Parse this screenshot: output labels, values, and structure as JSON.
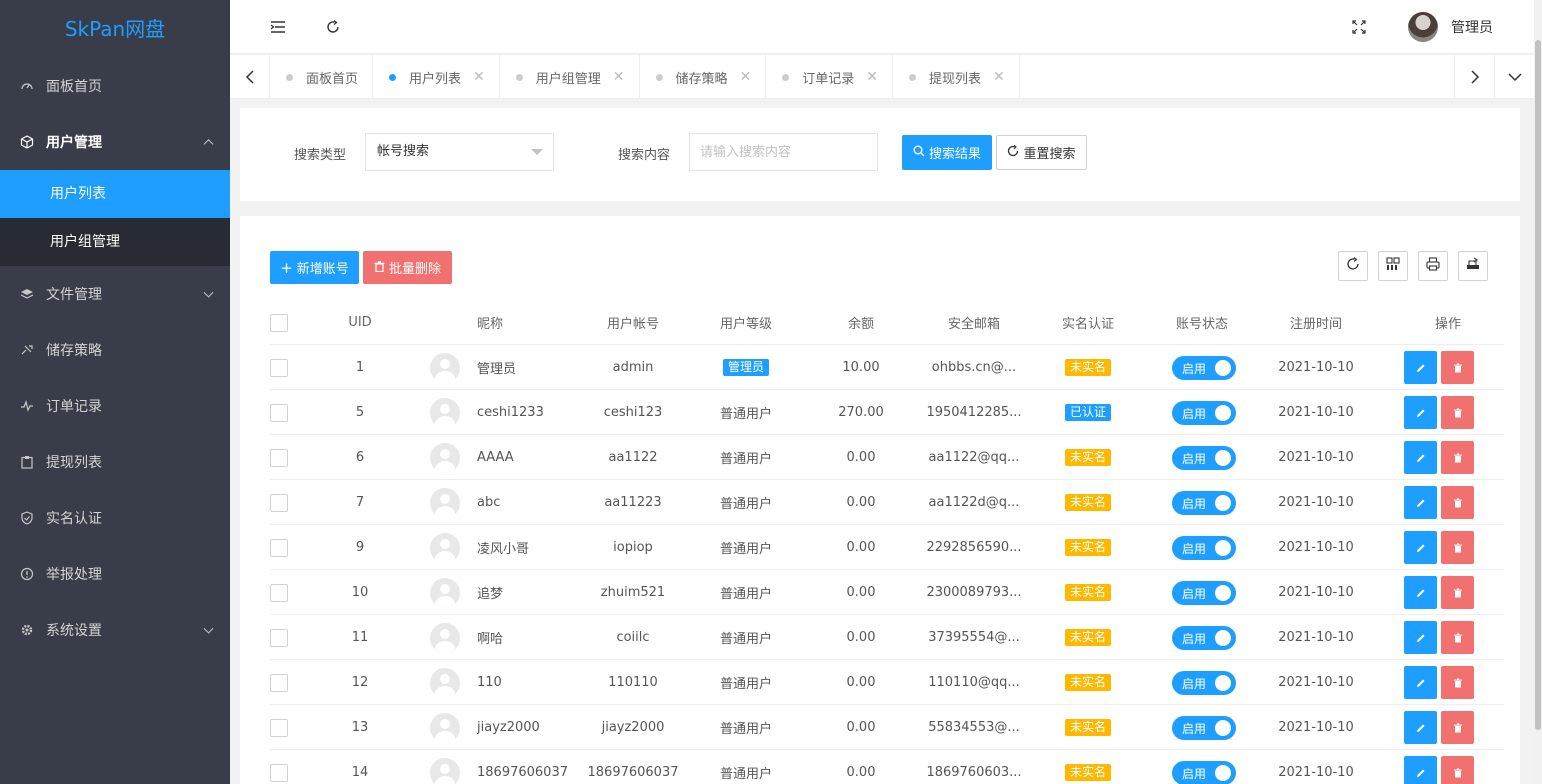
{
  "app": {
    "logo": "SkPan网盘"
  },
  "header": {
    "user_name": "管理员"
  },
  "sidebar": {
    "items": [
      {
        "label": "面板首页",
        "icon": "dashboard-icon"
      },
      {
        "label": "用户管理",
        "icon": "cube-icon",
        "open": true,
        "children": [
          {
            "label": "用户列表",
            "active": true
          },
          {
            "label": "用户组管理"
          }
        ]
      },
      {
        "label": "文件管理",
        "icon": "layers-icon"
      },
      {
        "label": "储存策略",
        "icon": "strategy-icon"
      },
      {
        "label": "订单记录",
        "icon": "pulse-icon"
      },
      {
        "label": "提现列表",
        "icon": "clipboard-icon"
      },
      {
        "label": "实名认证",
        "icon": "shield-check-icon"
      },
      {
        "label": "举报处理",
        "icon": "alert-circle-icon"
      },
      {
        "label": "系统设置",
        "icon": "gear-icon"
      }
    ]
  },
  "tabs": [
    {
      "label": "面板首页",
      "closable": false
    },
    {
      "label": "用户列表",
      "closable": true,
      "active": true
    },
    {
      "label": "用户组管理",
      "closable": true
    },
    {
      "label": "储存策略",
      "closable": true
    },
    {
      "label": "订单记录",
      "closable": true
    },
    {
      "label": "提现列表",
      "closable": true
    }
  ],
  "search": {
    "type_label": "搜索类型",
    "type_value": "帐号搜索",
    "content_label": "搜索内容",
    "content_placeholder": "请输入搜索内容",
    "search_button": "搜索结果",
    "reset_button": "重置搜索"
  },
  "toolbar": {
    "add_button": "新增账号",
    "batch_delete_button": "批量删除"
  },
  "table": {
    "columns": [
      "UID",
      "昵称",
      "用户帐号",
      "用户等级",
      "余额",
      "安全邮箱",
      "实名认证",
      "账号状态",
      "注册时间",
      "操作"
    ],
    "status_label": "启用",
    "rows": [
      {
        "uid": "1",
        "nickname": "管理员",
        "account": "admin",
        "level": "管理员",
        "balance": "10.00",
        "email": "ohbbs.cn@...",
        "verify": "未实名",
        "date": "2021-10-10"
      },
      {
        "uid": "5",
        "nickname": "ceshi1233",
        "account": "ceshi123",
        "level": "普通用户",
        "balance": "270.00",
        "email": "1950412285...",
        "verify": "已认证",
        "date": "2021-10-10"
      },
      {
        "uid": "6",
        "nickname": "AAAA",
        "account": "aa1122",
        "level": "普通用户",
        "balance": "0.00",
        "email": "aa1122@qq...",
        "verify": "未实名",
        "date": "2021-10-10"
      },
      {
        "uid": "7",
        "nickname": "abc",
        "account": "aa11223",
        "level": "普通用户",
        "balance": "0.00",
        "email": "aa1122d@q...",
        "verify": "未实名",
        "date": "2021-10-10"
      },
      {
        "uid": "9",
        "nickname": "凌风小哥",
        "account": "iopiop",
        "level": "普通用户",
        "balance": "0.00",
        "email": "2292856590...",
        "verify": "未实名",
        "date": "2021-10-10"
      },
      {
        "uid": "10",
        "nickname": "追梦",
        "account": "zhuim521",
        "level": "普通用户",
        "balance": "0.00",
        "email": "2300089793...",
        "verify": "未实名",
        "date": "2021-10-10"
      },
      {
        "uid": "11",
        "nickname": "啊哈",
        "account": "coiilc",
        "level": "普通用户",
        "balance": "0.00",
        "email": "37395554@...",
        "verify": "未实名",
        "date": "2021-10-10"
      },
      {
        "uid": "12",
        "nickname": "110",
        "account": "110110",
        "level": "普通用户",
        "balance": "0.00",
        "email": "110110@qq...",
        "verify": "未实名",
        "date": "2021-10-10"
      },
      {
        "uid": "13",
        "nickname": "jiayz2000",
        "account": "jiayz2000",
        "level": "普通用户",
        "balance": "0.00",
        "email": "55834553@...",
        "verify": "未实名",
        "date": "2021-10-10"
      },
      {
        "uid": "14",
        "nickname": "18697606037",
        "account": "18697606037",
        "level": "普通用户",
        "balance": "0.00",
        "email": "1869760603...",
        "verify": "未实名",
        "date": "2021-10-10"
      }
    ]
  },
  "colors": {
    "primary": "#1e9fff",
    "danger": "#f17070",
    "warning": "#ffb800",
    "sidebar": "#393d49"
  }
}
